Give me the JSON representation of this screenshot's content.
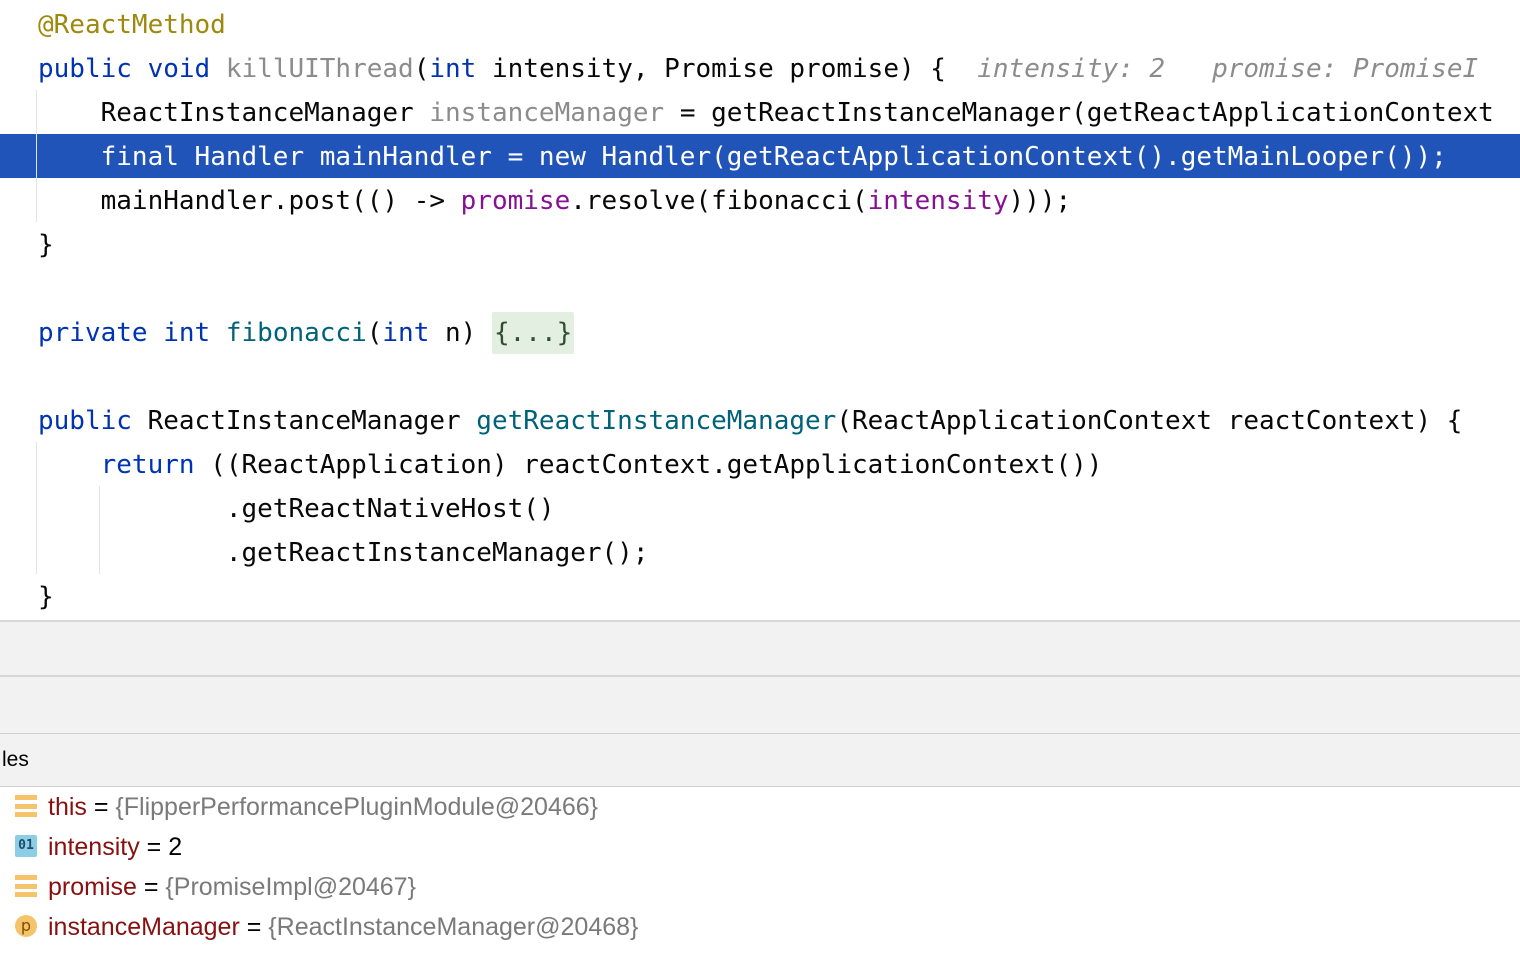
{
  "editor": {
    "lines": {
      "annotation": "@ReactMethod",
      "l2_public": "public",
      "l2_void": "void",
      "l2_method": "killUIThread",
      "l2_paren": "(",
      "l2_int": "int",
      "l2_rest": " intensity, Promise promise) {",
      "l2_hint1": "intensity: 2",
      "l2_hint2": "promise: PromiseI",
      "l3_type": "ReactInstanceManager",
      "l3_var": "instanceManager",
      "l3_rest": " = getReactInstanceManager(getReactApplicationContext",
      "l4_code": "final Handler mainHandler = new Handler(getReactApplicationContext().getMainLooper());",
      "l5_a": "mainHandler.post(() -> ",
      "l5_promise": "promise",
      "l5_b": ".resolve(fibonacci(",
      "l5_intensity": "intensity",
      "l5_c": ")));",
      "l6_brace": "}",
      "l8_private": "private",
      "l8_int": "int",
      "l8_fn": "fibonacci",
      "l8_paren": "(",
      "l8_int2": "int",
      "l8_rest": " n) ",
      "l8_fold": "{...}",
      "l10_public": "public",
      "l10_type": " ReactInstanceManager ",
      "l10_fn": "getReactInstanceManager",
      "l10_rest": "(ReactApplicationContext reactContext) {",
      "l11_return": "return",
      "l11_rest": " ((ReactApplication) reactContext.getApplicationContext())",
      "l12": ".getReactNativeHost()",
      "l13": ".getReactInstanceManager();",
      "l14_brace": "}"
    }
  },
  "variables_panel": {
    "header": "les",
    "items": [
      {
        "name": "this",
        "eq": " = ",
        "value": "{FlipperPerformancePluginModule@20466}",
        "icon": "field-icon"
      },
      {
        "name": "intensity",
        "eq": " = ",
        "value": "2",
        "icon": "primitive-icon",
        "icon_label": "01"
      },
      {
        "name": "promise",
        "eq": " = ",
        "value": "{PromiseImpl@20467}",
        "icon": "field-icon"
      },
      {
        "name": "instanceManager",
        "eq": " = ",
        "value": "{ReactInstanceManager@20468}",
        "icon": "parameter-icon",
        "icon_label": "p"
      }
    ]
  },
  "colors": {
    "execution_line": "#2154b9",
    "keyword": "#0033b3",
    "annotation": "#9e880d",
    "method_decl": "#00627a",
    "captured_var": "#871094",
    "var_name": "#871010"
  }
}
